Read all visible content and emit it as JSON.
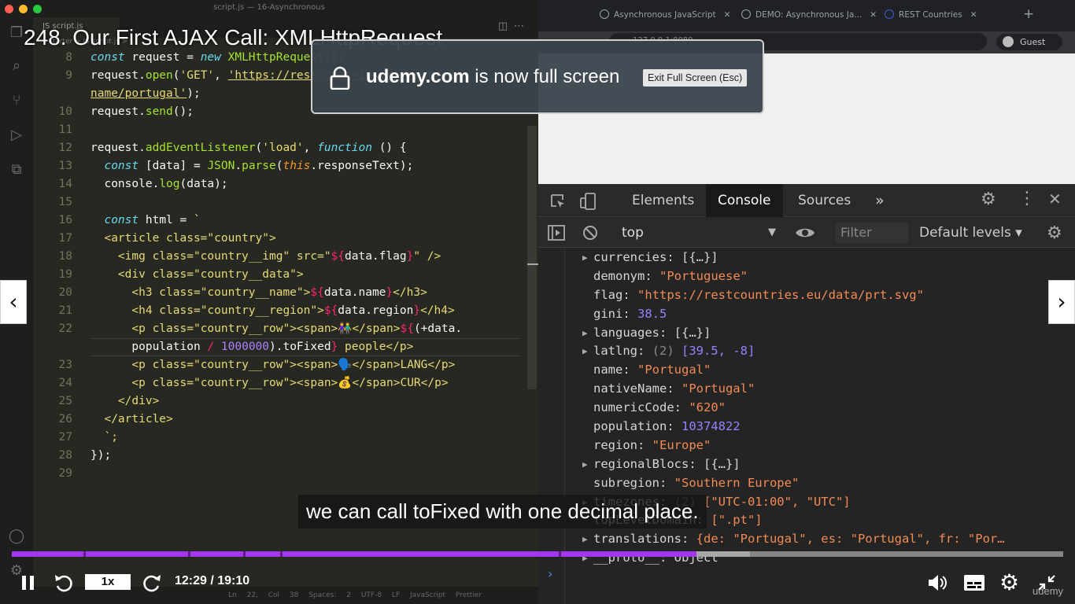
{
  "editor": {
    "window_title": "script.js — 16-Asynchronous",
    "tab_label": "JS script.js",
    "breadcrumb": "starter > JS script.js > ...",
    "status": "Ln 22, Col 38   Spaces: 2   UTF-8   LF   JavaScript   Prettier",
    "lines": [
      {
        "n": "8"
      },
      {
        "n": "9"
      },
      {
        "n": ""
      },
      {
        "n": "10"
      },
      {
        "n": "11"
      },
      {
        "n": "12"
      },
      {
        "n": "13"
      },
      {
        "n": "14"
      },
      {
        "n": "15"
      },
      {
        "n": "16"
      },
      {
        "n": "17"
      },
      {
        "n": "18"
      },
      {
        "n": "19"
      },
      {
        "n": "20"
      },
      {
        "n": "21"
      },
      {
        "n": "22"
      },
      {
        "n": ""
      },
      {
        "n": "23"
      },
      {
        "n": "24"
      },
      {
        "n": "25"
      },
      {
        "n": "26"
      },
      {
        "n": "27"
      },
      {
        "n": "28"
      },
      {
        "n": "29"
      }
    ],
    "code": {
      "l8": [
        "const",
        " request = ",
        "new",
        " XMLHttpRequest();"
      ],
      "l9": [
        "request.",
        "open",
        "(",
        "'GET'",
        ", ",
        "'https://restcountries.eu/rest/v2/"
      ],
      "l9b": [
        "name/portugal'",
        ");"
      ],
      "l10": [
        "request.",
        "send",
        "();"
      ],
      "l12": [
        "request.",
        "addEventListener",
        "(",
        "'load'",
        ", ",
        "function",
        " () {"
      ],
      "l13": [
        "  ",
        "const",
        " [data] = ",
        "JSON",
        ".",
        "parse",
        "(",
        "this",
        ".responseText);"
      ],
      "l14": [
        "  console.",
        "log",
        "(data);"
      ],
      "l16": [
        "  ",
        "const",
        " html = ",
        "`"
      ],
      "l17": [
        "  ",
        "<article class=\"country\">"
      ],
      "l18": [
        "    ",
        "<img class=\"country__img\" src=\"",
        "${",
        "data.flag",
        "}",
        "\" />"
      ],
      "l19": [
        "    ",
        "<div class=\"country__data\">"
      ],
      "l20": [
        "      ",
        "<h3 class=\"country__name\">",
        "${",
        "data.name",
        "}",
        "</h3>"
      ],
      "l21": [
        "      ",
        "<h4 class=\"country__region\">",
        "${",
        "data.region",
        "}",
        "</h4>"
      ],
      "l22": [
        "      ",
        "<p class=\"country__row\"><span>",
        "👫",
        "</span>",
        "${",
        "(+data."
      ],
      "l22b": [
        "      ",
        "population",
        " / ",
        "1000000",
        ").toFixed",
        "}",
        " people</p>"
      ],
      "l23": [
        "      ",
        "<p class=\"country__row\"><span>",
        "🗣️",
        "</span>LANG</p>"
      ],
      "l24": [
        "      ",
        "<p class=\"country__row\"><span>",
        "💰",
        "</span>CUR</p>"
      ],
      "l25": [
        "    ",
        "</div>"
      ],
      "l26": [
        "  ",
        "</article>"
      ],
      "l27": [
        "  ",
        "`;"
      ],
      "l28": [
        "});"
      ]
    }
  },
  "browser": {
    "tabs": [
      {
        "label": "Asynchronous JavaScript"
      },
      {
        "label": "DEMO: Asynchronous Ja..."
      },
      {
        "label": "REST Countries"
      }
    ],
    "address": "127.0.0.1:8080",
    "guest_label": "Guest"
  },
  "devtools": {
    "tabs": [
      "Elements",
      "Console",
      "Sources"
    ],
    "more_tabs": "»",
    "context": "top",
    "filter_placeholder": "Filter",
    "levels": "Default levels ▾",
    "rows": [
      {
        "exp": true,
        "key": "currencies",
        "val": "[{…}]",
        "kind": "plain"
      },
      {
        "exp": false,
        "key": "demonym",
        "val": "\"Portuguese\"",
        "kind": "str"
      },
      {
        "exp": false,
        "key": "flag",
        "val": "\"https://restcountries.eu/data/prt.svg\"",
        "kind": "str"
      },
      {
        "exp": false,
        "key": "gini",
        "val": "38.5",
        "kind": "num"
      },
      {
        "exp": true,
        "key": "languages",
        "val": "[{…}]",
        "kind": "plain"
      },
      {
        "exp": true,
        "key": "latlng",
        "pre": "(2) ",
        "val": "[39.5, -8]",
        "kind": "arr"
      },
      {
        "exp": false,
        "key": "name",
        "val": "\"Portugal\"",
        "kind": "str"
      },
      {
        "exp": false,
        "key": "nativeName",
        "val": "\"Portugal\"",
        "kind": "str"
      },
      {
        "exp": false,
        "key": "numericCode",
        "val": "\"620\"",
        "kind": "str"
      },
      {
        "exp": false,
        "key": "population",
        "val": "10374822",
        "kind": "num"
      },
      {
        "exp": false,
        "key": "region",
        "val": "\"Europe\"",
        "kind": "str"
      },
      {
        "exp": true,
        "key": "regionalBlocs",
        "val": "[{…}]",
        "kind": "plain"
      },
      {
        "exp": false,
        "key": "subregion",
        "val": "\"Southern Europe\"",
        "kind": "str"
      },
      {
        "exp": true,
        "key": "timezones",
        "pre": "(2) ",
        "val": "[\"UTC-01:00\", \"UTC\"]",
        "kind": "str"
      },
      {
        "exp": false,
        "key": "topLevelDomain",
        "val": "[\".pt\"]",
        "kind": "str"
      },
      {
        "exp": true,
        "key": "translations",
        "val": "{de: \"Portugal\", es: \"Portugal\", fr: \"Por…",
        "kind": "str"
      },
      {
        "exp": true,
        "key": "__proto__",
        "val": "Object",
        "kind": "plain"
      }
    ],
    "prompt": "›"
  },
  "player": {
    "video_title": "248. Our First AJAX Call: XMLHttpRequest",
    "fs_domain": "udemy.com",
    "fs_text": " is now full screen",
    "fs_exit": "Exit Full Screen (Esc)",
    "caption": "we can call toFixed with one decimal place.",
    "speed": "1x",
    "time": "12:29 / 19:10",
    "progress_fraction": 0.651,
    "buffered_fraction": 0.702,
    "chapter_fractions": [
      0.068,
      0.168,
      0.22,
      0.255,
      0.52
    ],
    "brand": "udemy",
    "colors": {
      "accent": "#a435f0"
    }
  }
}
